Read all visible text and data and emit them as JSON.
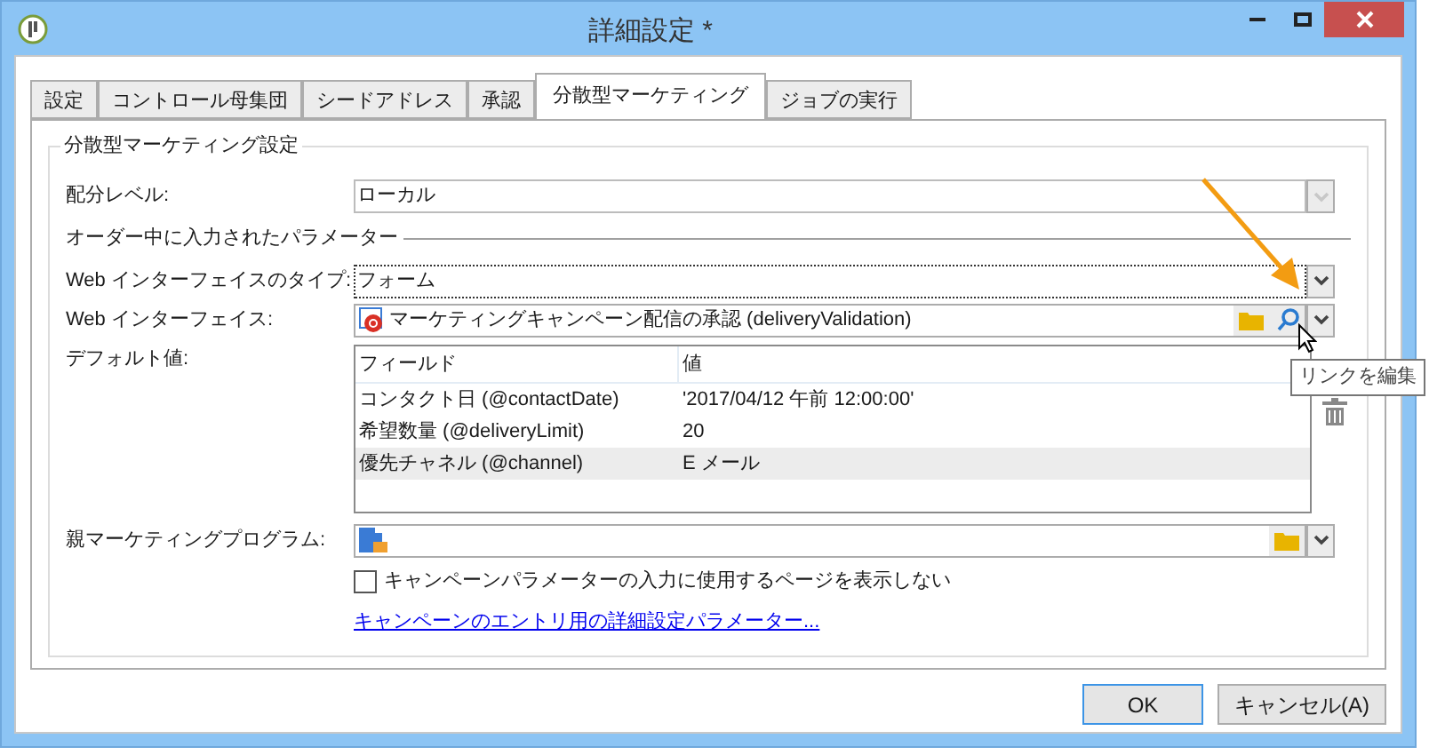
{
  "window": {
    "title": "詳細設定 *"
  },
  "tabs": [
    {
      "label": "設定",
      "selected": false
    },
    {
      "label": "コントロール母集団",
      "selected": false
    },
    {
      "label": "シードアドレス",
      "selected": false
    },
    {
      "label": "承認",
      "selected": false
    },
    {
      "label": "分散型マーケティング",
      "selected": true
    },
    {
      "label": "ジョブの実行",
      "selected": false
    }
  ],
  "group": {
    "title": "分散型マーケティング設定",
    "distribution_level": {
      "label": "配分レベル:",
      "value": "ローカル",
      "disabled": true
    },
    "section_title": "オーダー中に入力されたパラメーター",
    "web_interface_type": {
      "label": "Web インターフェイスのタイプ:",
      "value": "フォーム",
      "focused": true
    },
    "web_interface": {
      "label": "Web インターフェイス:",
      "value": "マーケティングキャンペーン配信の承認 (deliveryValidation)"
    },
    "default_values": {
      "label": "デフォルト値:",
      "columns": [
        "フィールド",
        "値"
      ],
      "rows": [
        {
          "field": "コンタクト日 (@contactDate)",
          "value": "'2017/04/12 午前 12:00:00'",
          "selected": false
        },
        {
          "field": "希望数量 (@deliveryLimit)",
          "value": "20",
          "selected": false
        },
        {
          "field": "優先チャネル (@channel)",
          "value": "E メール",
          "selected": true
        }
      ]
    },
    "tooltip": "リンクを編集",
    "parent_program": {
      "label": "親マーケティングプログラム:"
    },
    "hide_page": {
      "label": "キャンペーンパラメーターの入力に使用するページを表示しない",
      "checked": false
    },
    "link": "キャンペーンのエントリ用の詳細設定パラメーター..."
  },
  "buttons": [
    {
      "label": "OK",
      "default": true
    },
    {
      "label": "キャンセル(A)",
      "default": false
    }
  ]
}
